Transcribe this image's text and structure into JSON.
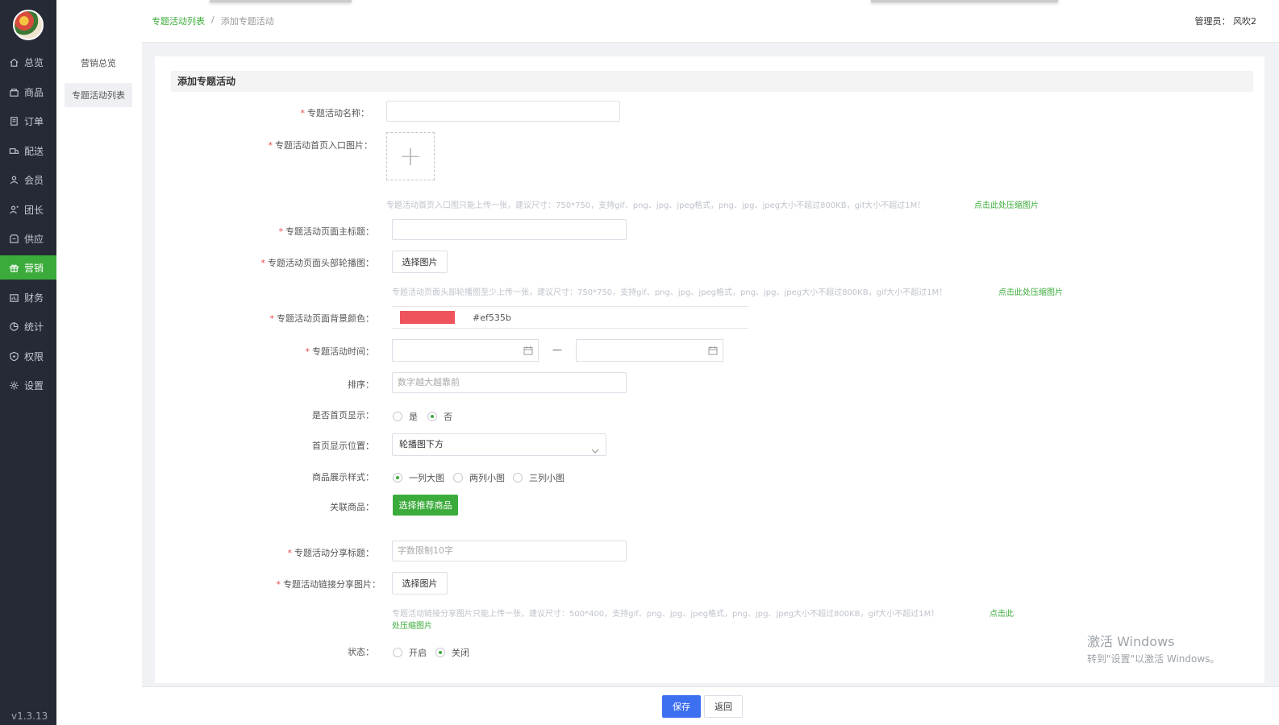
{
  "sidebar": {
    "items": [
      {
        "label": "总览",
        "icon": "home-icon"
      },
      {
        "label": "商品",
        "icon": "shop-icon"
      },
      {
        "label": "订单",
        "icon": "order-icon"
      },
      {
        "label": "配送",
        "icon": "delivery-icon"
      },
      {
        "label": "会员",
        "icon": "member-icon"
      },
      {
        "label": "团长",
        "icon": "leader-icon"
      },
      {
        "label": "供应",
        "icon": "supply-icon"
      },
      {
        "label": "营销",
        "icon": "gift-icon",
        "active": true
      },
      {
        "label": "财务",
        "icon": "finance-icon"
      },
      {
        "label": "统计",
        "icon": "chart-pie-icon"
      },
      {
        "label": "权限",
        "icon": "shield-icon"
      },
      {
        "label": "设置",
        "icon": "gear-icon"
      }
    ],
    "version": "v1.3.13"
  },
  "subnav": {
    "items": [
      {
        "label": "营销总览"
      },
      {
        "label": "专题活动列表",
        "active": true
      }
    ]
  },
  "header": {
    "breadcrumb_link": "专题活动列表",
    "breadcrumb_sep": "/",
    "breadcrumb_current": "添加专题活动",
    "manager": "管理员： 风吹2"
  },
  "form": {
    "section_title": "添加专题活动",
    "name_label": "专题活动名称：",
    "name_value": "",
    "entry_img_label": "专题活动首页入口图片：",
    "entry_img_hint": "专题活动首页入口图只能上传一张，建议尺寸：750*750，支持gif、png、jpg、jpeg格式，png、jpg、jpeg大小不超过800KB，gif大小不超过1M！",
    "compress_link": "点击此处压缩图片",
    "main_title_label": "专题活动页面主标题：",
    "main_title_value": "",
    "banner_label": "专题活动页面头部轮播图：",
    "choose_img": "选择图片",
    "banner_hint": "专题活动页面头部轮播图至少上传一张，建议尺寸：750*750，支持gif、png、jpg、jpeg格式，png、jpg、jpeg大小不超过800KB，gif大小不超过1M！",
    "bg_color_label": "专题活动页面背景颜色：",
    "bg_color_value": "#ef535b",
    "bg_color_hex": "#ef535b",
    "time_label": "专题活动时间：",
    "time_dash": "—",
    "sort_label": "排序：",
    "sort_placeholder": "数字越大越靠前",
    "home_show_label": "是否首页显示：",
    "yes": "是",
    "no": "否",
    "home_position_label": "首页显示位置：",
    "home_position_value": "轮播图下方",
    "goods_style_label": "商品展示样式：",
    "style_opt1": "一列大图",
    "style_opt2": "两列小图",
    "style_opt3": "三列小图",
    "related_goods_label": "关联商品：",
    "select_goods_btn": "选择推荐商品",
    "share_title_label": "专题活动分享标题：",
    "share_title_placeholder": "字数限制10字",
    "share_img_label": "专题活动链接分享图片：",
    "share_img_hint": "专题活动链接分享图片只能上传一张，建议尺寸：500*400，支持gif、png、jpg、jpeg格式，png、jpg、jpeg大小不超过800KB，gif大小不超过1M！",
    "share_compress_link_1": "点击此",
    "share_compress_link_2": "处压缩图片",
    "status_label": "状态：",
    "status_on": "开启",
    "status_off": "关闭"
  },
  "footer": {
    "save": "保存",
    "back": "返回"
  },
  "watermark": {
    "line1": "激活 Windows",
    "line2": "转到\"设置\"以激活 Windows。"
  },
  "colors": {
    "accent_green": "#3bab3b",
    "primary_blue": "#3d6ff1",
    "sidebar_bg": "#262a36",
    "swatch": "#ef535b"
  }
}
